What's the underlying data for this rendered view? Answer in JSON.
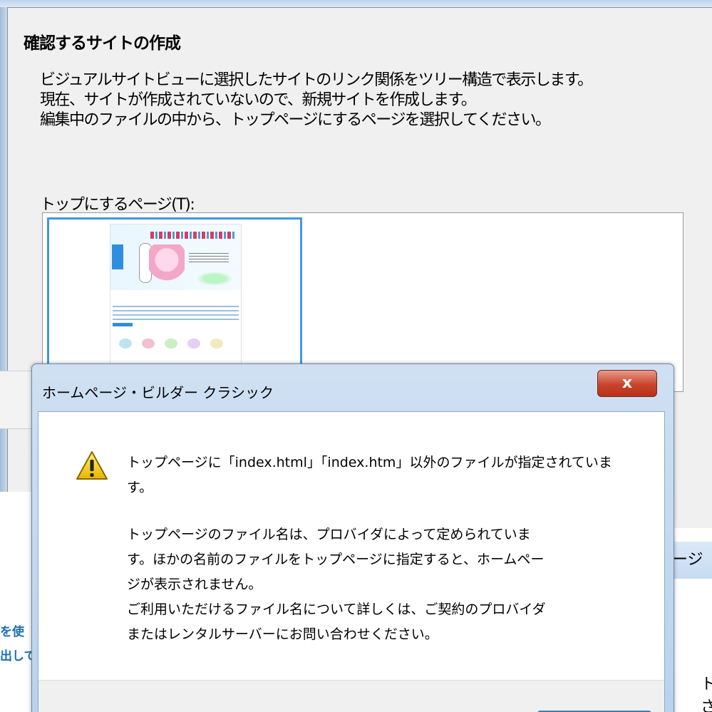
{
  "background_dialog": {
    "heading": "確認するサイトの作成",
    "description_lines": [
      "ビジュアルサイトビューに選択したサイトのリンク関係をツリー構造で表示します。",
      "現在、サイトが作成されていないので、新規サイトを作成します。",
      "編集中のファイルの中から、トップページにするページを選択してください。"
    ],
    "toppage_label": "トップにするページ(T):"
  },
  "background_window_left": {
    "link_line_1": "を使",
    "link_line_2": "出して"
  },
  "background_window_right": {
    "title_fragment": "ージ",
    "text_line_1": "ト",
    "text_line_2": "さ"
  },
  "alert": {
    "title": "ホームページ・ビルダー クラシック",
    "close_label": "x",
    "message_paragraph_1": "トップページに「index.html」「index.htm」以外のファイルが指定されています。",
    "message_paragraph_2_lines": [
      "トップページのファイル名は、プロバイダによって定められていま",
      "す。ほかの名前のファイルをトップページに指定すると、ホームペー",
      "ジが表示されません。",
      "ご利用いただけるファイル名について詳しくは、ご契約のプロバイダ",
      "またはレンタルサーバーにお問い合わせください。"
    ]
  },
  "icons": {
    "warning": "warning-icon",
    "close": "close-icon"
  },
  "colors": {
    "selection_border": "#3e97e6",
    "close_button": "#c9442c",
    "title_bar": "#c6dcf2",
    "link_text": "#1b6fb3"
  }
}
